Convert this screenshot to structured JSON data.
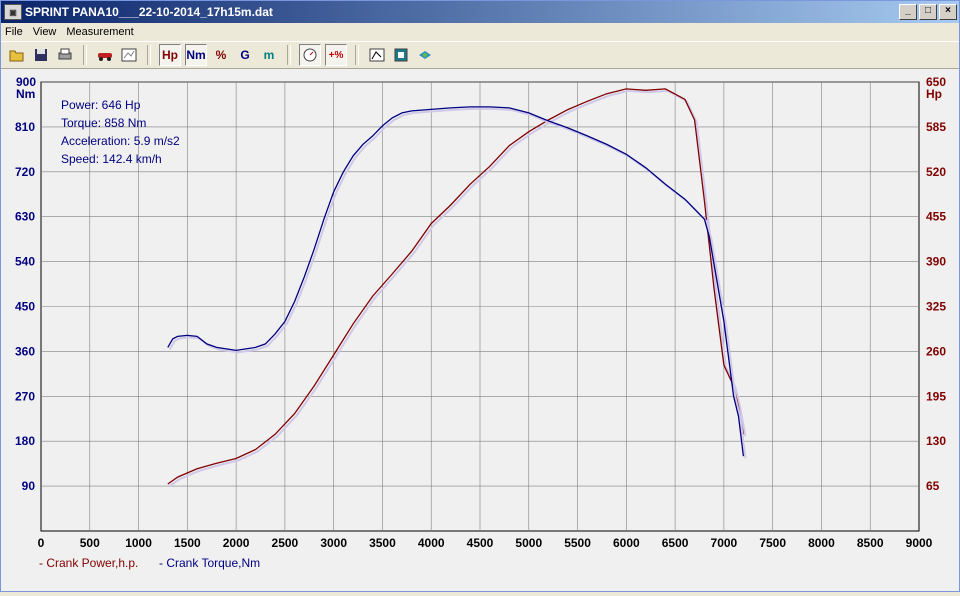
{
  "window": {
    "title": "SPRINT  PANA10___22-10-2014_17h15m.dat",
    "controls": {
      "minimize": "_",
      "maximize": "□",
      "close": "×"
    }
  },
  "menu": [
    "File",
    "View",
    "Measurement"
  ],
  "toolbar": {
    "icons": [
      "open-icon",
      "save-icon",
      "print-icon",
      "car-icon",
      "graph-settings-icon",
      "hp-toggle",
      "nm-toggle",
      "percent-toggle",
      "g-toggle",
      "m-toggle",
      "gauge-icon",
      "plus-percent-icon",
      "chart-icon",
      "export-icon",
      "upload-icon"
    ],
    "hp_label": "Hp",
    "nm_label": "Nm",
    "pct_label": "%",
    "g_label": "G",
    "m_label": "m",
    "plus_pct_label": "+%"
  },
  "readout": {
    "power": "Power: 646 Hp",
    "torque": "Torque: 858 Nm",
    "acceleration": "Acceleration: 5.9 m/s2",
    "speed": "Speed: 142.4 km/h"
  },
  "legend": {
    "power": "- Crank Power,h.p.",
    "torque": "- Crank Torque,Nm"
  },
  "colors": {
    "power": "#800000",
    "torque": "#000080",
    "grid": "#808080",
    "plot_bg": "#f0f0f0"
  },
  "chart_data": {
    "type": "line",
    "xlim": [
      0,
      9000
    ],
    "x_ticks": [
      0,
      500,
      1000,
      1500,
      2000,
      2500,
      3000,
      3500,
      4000,
      4500,
      5000,
      5500,
      6000,
      6500,
      7000,
      7500,
      8000,
      8500,
      9000
    ],
    "left_axis": {
      "unit": "Nm",
      "ylim": [
        0,
        900
      ],
      "ticks": [
        90,
        180,
        270,
        360,
        450,
        540,
        630,
        720,
        810,
        900
      ]
    },
    "right_axis": {
      "unit": "Hp",
      "ylim": [
        0,
        650
      ],
      "ticks": [
        65,
        130,
        195,
        260,
        325,
        390,
        455,
        520,
        585,
        650
      ]
    },
    "grid": true,
    "legend_position": "bottom-left",
    "series": [
      {
        "name": "Crank Power,h.p.",
        "axis": "right",
        "x": [
          1300,
          1400,
          1600,
          1800,
          2000,
          2200,
          2400,
          2600,
          2800,
          3000,
          3200,
          3400,
          3600,
          3800,
          4000,
          4200,
          4400,
          4600,
          4800,
          5000,
          5200,
          5400,
          5600,
          5800,
          6000,
          6200,
          6400,
          6600,
          6700,
          6800,
          6900,
          7000,
          7100,
          7150,
          7200
        ],
        "y": [
          68,
          78,
          90,
          98,
          105,
          118,
          140,
          170,
          210,
          255,
          300,
          340,
          372,
          405,
          445,
          472,
          502,
          528,
          558,
          578,
          595,
          610,
          622,
          633,
          640,
          638,
          640,
          625,
          595,
          478,
          350,
          240,
          210,
          180,
          140
        ]
      },
      {
        "name": "Crank Torque,Nm",
        "axis": "left",
        "x": [
          1300,
          1350,
          1400,
          1500,
          1600,
          1700,
          1800,
          1900,
          2000,
          2100,
          2200,
          2300,
          2400,
          2500,
          2600,
          2700,
          2800,
          2900,
          3000,
          3100,
          3200,
          3300,
          3400,
          3500,
          3600,
          3700,
          3800,
          4000,
          4200,
          4400,
          4600,
          4800,
          5000,
          5200,
          5400,
          5600,
          5800,
          6000,
          6200,
          6400,
          6600,
          6800,
          6850,
          7000,
          7100,
          7150,
          7200
        ],
        "y": [
          368,
          385,
          390,
          392,
          390,
          375,
          368,
          365,
          362,
          365,
          368,
          375,
          395,
          420,
          460,
          510,
          565,
          625,
          680,
          720,
          752,
          775,
          792,
          812,
          828,
          838,
          842,
          845,
          848,
          850,
          850,
          848,
          838,
          822,
          808,
          792,
          775,
          755,
          728,
          695,
          665,
          625,
          590,
          420,
          270,
          230,
          150
        ]
      }
    ]
  }
}
